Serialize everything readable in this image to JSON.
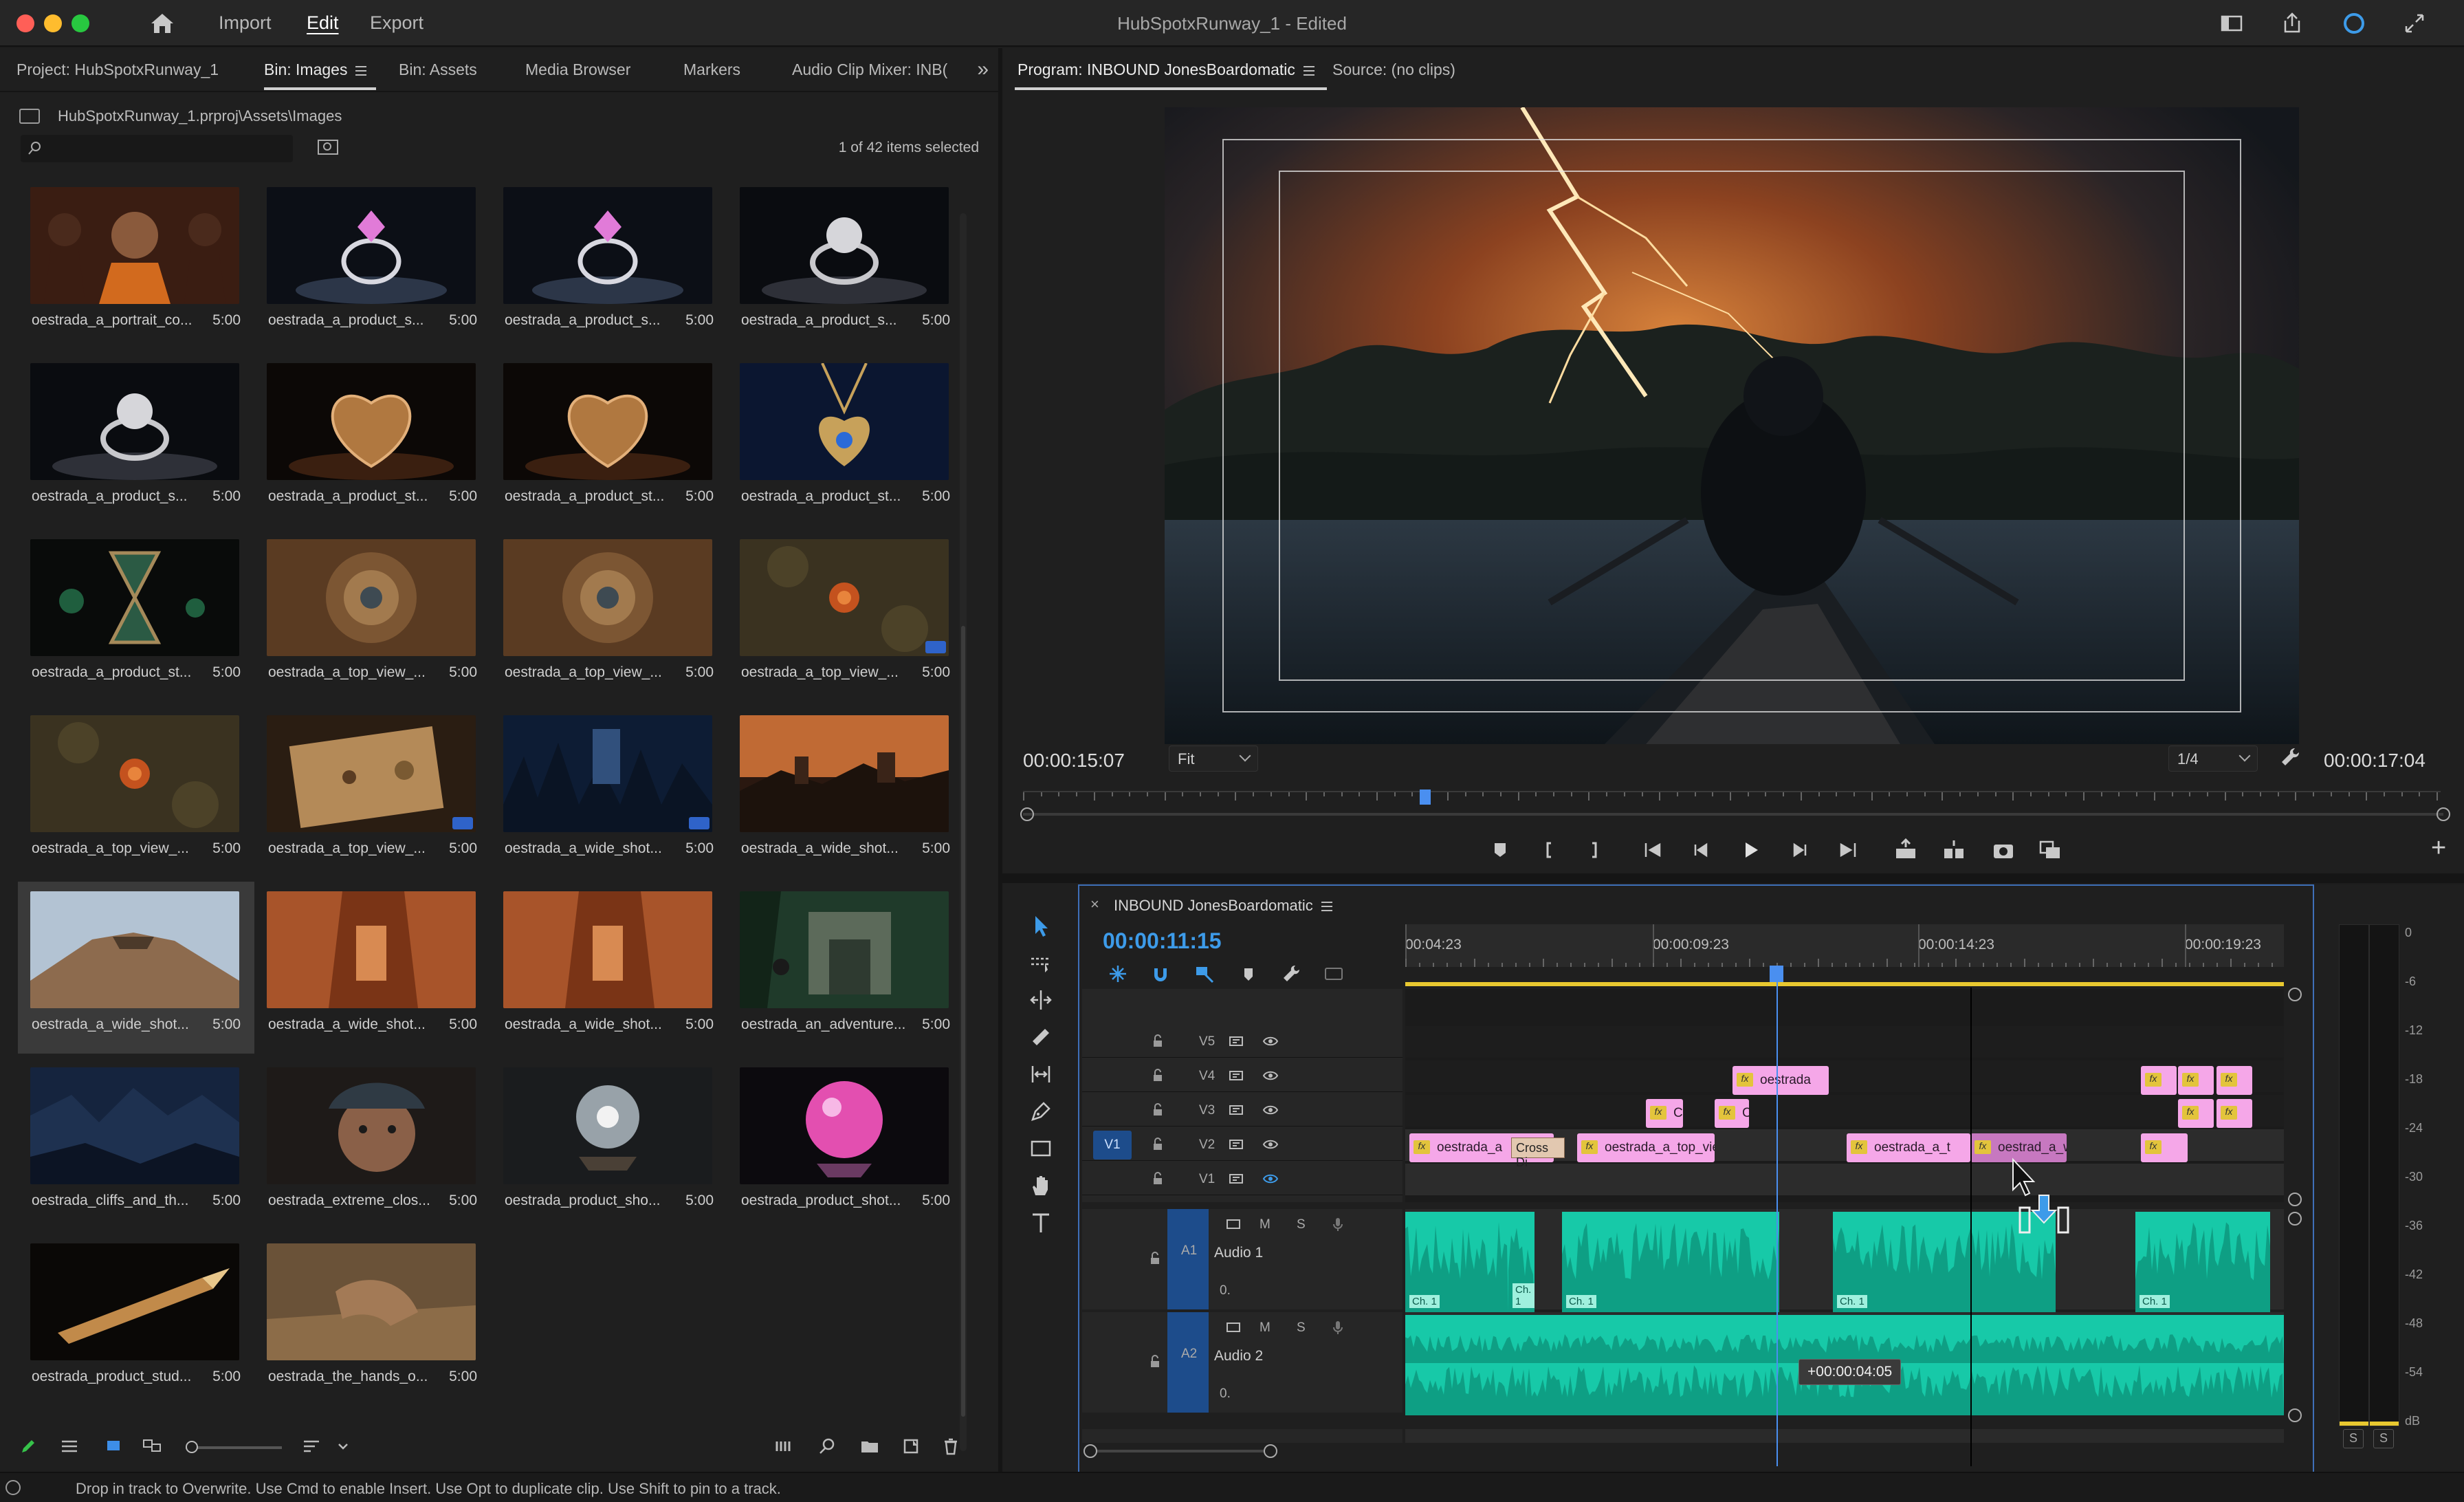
{
  "window": {
    "title": "HubSpotxRunway_1 - Edited",
    "menu": [
      "Import",
      "Edit",
      "Export"
    ],
    "active_menu": "Edit"
  },
  "project_panel": {
    "tabs": [
      "Project: HubSpotxRunway_1",
      "Bin: Images",
      "Bin: Assets",
      "Media Browser",
      "Markers",
      "Audio Clip Mixer: INB("
    ],
    "active_tab": "Bin: Images",
    "path": "HubSpotxRunway_1.prproj\\Assets\\Images",
    "search_placeholder": "",
    "items_count": "1 of 42 items selected",
    "items": [
      {
        "name": "oestrada_a_portrait_co...",
        "duration": "5:00",
        "icon": "portrait-crowd",
        "badge": false
      },
      {
        "name": "oestrada_a_product_s...",
        "duration": "5:00",
        "icon": "ring-pink",
        "badge": false
      },
      {
        "name": "oestrada_a_product_s...",
        "duration": "5:00",
        "icon": "ring-pink",
        "badge": false
      },
      {
        "name": "oestrada_a_product_s...",
        "duration": "5:00",
        "icon": "ring-silver",
        "badge": false
      },
      {
        "name": "oestrada_a_product_s...",
        "duration": "5:00",
        "icon": "ring-silver",
        "badge": false
      },
      {
        "name": "oestrada_a_product_st...",
        "duration": "5:00",
        "icon": "heart-locket",
        "badge": false
      },
      {
        "name": "oestrada_a_product_st...",
        "duration": "5:00",
        "icon": "heart-locket",
        "badge": false
      },
      {
        "name": "oestrada_a_product_st...",
        "duration": "5:00",
        "icon": "heart-pendant-blue",
        "badge": false
      },
      {
        "name": "oestrada_a_product_st...",
        "duration": "5:00",
        "icon": "hourglass",
        "badge": false
      },
      {
        "name": "oestrada_a_top_view_...",
        "duration": "5:00",
        "icon": "compass",
        "badge": false
      },
      {
        "name": "oestrada_a_top_view_...",
        "duration": "5:00",
        "icon": "compass",
        "badge": false
      },
      {
        "name": "oestrada_a_top_view_...",
        "duration": "5:00",
        "icon": "amulet",
        "badge": true
      },
      {
        "name": "oestrada_a_top_view_...",
        "duration": "5:00",
        "icon": "amulet",
        "badge": false
      },
      {
        "name": "oestrada_a_top_view_...",
        "duration": "5:00",
        "icon": "map",
        "badge": true
      },
      {
        "name": "oestrada_a_wide_shot...",
        "duration": "5:00",
        "icon": "night-forest",
        "badge": true
      },
      {
        "name": "oestrada_a_wide_shot...",
        "duration": "5:00",
        "icon": "sunset-ruins",
        "badge": false
      },
      {
        "name": "oestrada_a_wide_shot...",
        "duration": "5:00",
        "icon": "volcano",
        "badge": false
      },
      {
        "name": "oestrada_a_wide_shot...",
        "duration": "5:00",
        "icon": "canyon",
        "badge": false
      },
      {
        "name": "oestrada_a_wide_shot...",
        "duration": "5:00",
        "icon": "canyon",
        "badge": false
      },
      {
        "name": "oestrada_an_adventure...",
        "duration": "5:00",
        "icon": "jungle-temple",
        "badge": false
      },
      {
        "name": "oestrada_cliffs_and_th...",
        "duration": "5:00",
        "icon": "cliffs",
        "badge": false
      },
      {
        "name": "oestrada_extreme_clos...",
        "duration": "5:00",
        "icon": "explorer-face",
        "badge": false
      },
      {
        "name": "oestrada_product_sho...",
        "duration": "5:00",
        "icon": "crystal-ball",
        "badge": false
      },
      {
        "name": "oestrada_product_shot...",
        "duration": "5:00",
        "icon": "pink-orb",
        "badge": false
      },
      {
        "name": "oestrada_product_stud...",
        "duration": "5:00",
        "icon": "fountain-pen",
        "badge": false
      },
      {
        "name": "oestrada_the_hands_o...",
        "duration": "5:00",
        "icon": "hands-sand",
        "badge": false
      }
    ],
    "selected_index": 16
  },
  "program_monitor": {
    "tabs": [
      "Program: INBOUND JonesBoardomatic",
      "Source: (no clips)"
    ],
    "active_tab": "Program: INBOUND JonesBoardomatic",
    "timecode_in": "00:00:15:07",
    "timecode_out": "00:00:17:04",
    "fit": "Fit",
    "resolution": "1/4",
    "playhead_fraction": 0.28
  },
  "timeline": {
    "title": "INBOUND JonesBoardomatic",
    "timecode": "00:00:11:15",
    "ruler_labels": [
      "00:04:23",
      "00:00:09:23",
      "00:00:14:23",
      "00:00:19:23"
    ],
    "video_tracks": [
      "V5",
      "V4",
      "V3",
      "V2",
      "V1"
    ],
    "source_patch": "V1",
    "audio_tracks": [
      {
        "id": "A1",
        "name": "Audio 1"
      },
      {
        "id": "A2",
        "name": "Audio 2"
      }
    ],
    "audio_controls": {
      "mute": "M",
      "solo": "S",
      "volume": "0."
    },
    "clips": {
      "v4": "oestrada",
      "v3_a": "Cro",
      "v3_b": "Cro",
      "v2_a": "oestrada_a",
      "v2_trans": "Cross Di",
      "v2_b": "oestrada_a_top_vie",
      "v2_c": "oestrada_a_t",
      "v2_d": "oestrad_a_wid",
      "fx": "fx"
    },
    "clip_chip": "Ch. 1",
    "tooltip": "+00:00:04:05"
  },
  "audio_meter": {
    "labels": [
      "0",
      "-6",
      "-12",
      "-18",
      "-24",
      "-30",
      "-36",
      "-42",
      "-48",
      "-54",
      "dB"
    ],
    "solo": "S"
  },
  "status_bar": {
    "text": "Drop in track to Overwrite. Use Cmd to enable Insert. Use Opt to duplicate clip. Use Shift to pin to a track."
  },
  "colors": {
    "accent": "#3d9be9",
    "clip_video": "#f5a7e8",
    "clip_audio": "#17c9a8",
    "work_area": "#e8c830",
    "source_patch": "#1d4c8b"
  }
}
